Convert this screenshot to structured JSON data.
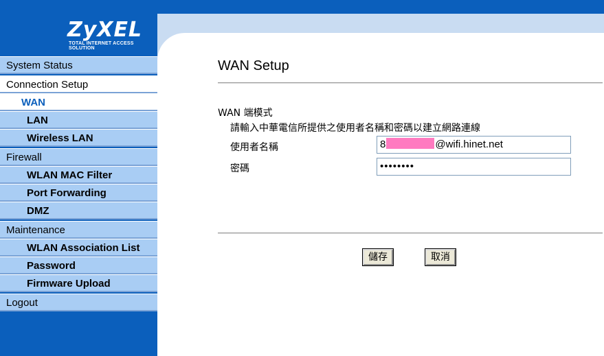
{
  "brand": {
    "name": "ZyXEL",
    "tagline": "TOTAL INTERNET ACCESS SOLUTION"
  },
  "sidebar": {
    "items": [
      {
        "label": "System Status",
        "kind": "section"
      },
      {
        "label": "Connection Setup",
        "kind": "section",
        "active": true
      },
      {
        "label": "WAN",
        "kind": "sub",
        "active": true
      },
      {
        "label": "LAN",
        "kind": "sub"
      },
      {
        "label": "Wireless LAN",
        "kind": "sub"
      },
      {
        "label": "Firewall",
        "kind": "section"
      },
      {
        "label": "WLAN MAC Filter",
        "kind": "sub"
      },
      {
        "label": "Port Forwarding",
        "kind": "sub"
      },
      {
        "label": "DMZ",
        "kind": "sub"
      },
      {
        "label": "Maintenance",
        "kind": "section"
      },
      {
        "label": "WLAN Association List",
        "kind": "sub"
      },
      {
        "label": "Password",
        "kind": "sub"
      },
      {
        "label": "Firmware Upload",
        "kind": "sub"
      },
      {
        "label": "Logout",
        "kind": "section"
      }
    ]
  },
  "main": {
    "title": "WAN Setup",
    "mode_label": "WAN 端模式",
    "instructions": "請輸入中華電信所提供之使用者名稱和密碼以建立網路連線",
    "username_label": "使用者名稱",
    "username_prefix": "8",
    "username_suffix": "@wifi.hinet.net",
    "password_label": "密碼",
    "password_value": "••••••••",
    "save_label": "儲存",
    "cancel_label": "取消"
  },
  "colors": {
    "nav_blue": "#0b5fbc",
    "nav_item": "#a9cdf4",
    "redaction": "#ff7ac0"
  }
}
